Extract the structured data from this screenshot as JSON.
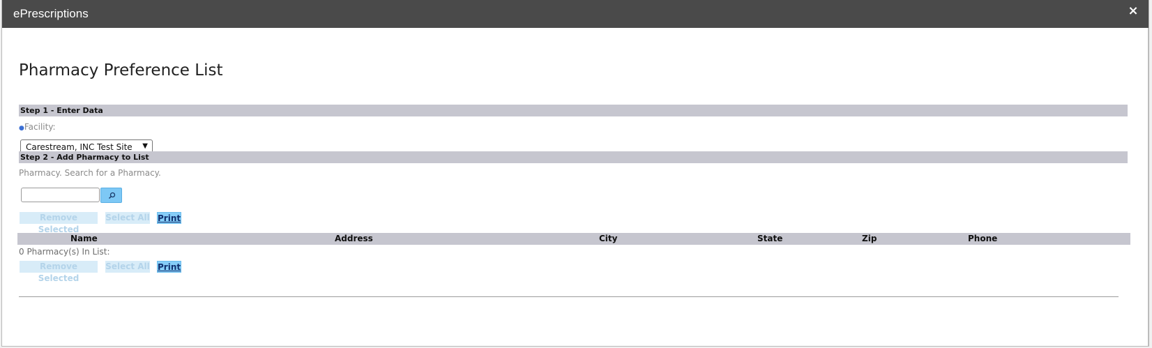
{
  "window": {
    "title": "ePrescriptions",
    "close_label": "×"
  },
  "page": {
    "title": "Pharmacy Preference List"
  },
  "step1": {
    "header": "Step 1 - Enter Data",
    "facility_label": "Facility:",
    "facility_value": "Carestream, INC Test Site"
  },
  "step2": {
    "header": "Step 2 - Add Pharmacy to List",
    "pharmacy_label": "Pharmacy. Search for a Pharmacy.",
    "search_value": ""
  },
  "actions": {
    "remove_selected": "Remove Selected",
    "select_all": "Select All",
    "print": "Print"
  },
  "table": {
    "columns": [
      "Name",
      "Address",
      "City",
      "State",
      "Zip",
      "Phone"
    ],
    "count_text": "0 Pharmacy(s) In List:"
  },
  "colors": {
    "titlebar": "#4a4a4a",
    "section_bar": "#c6c6cf",
    "primary_button": "#86cdf8",
    "disabled_button": "#d8ecf8"
  }
}
